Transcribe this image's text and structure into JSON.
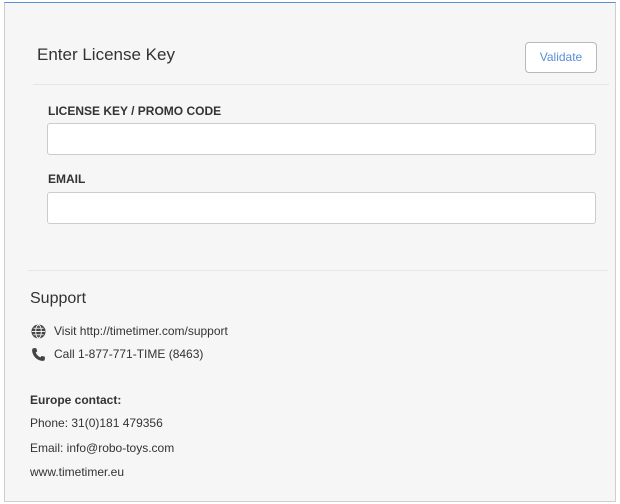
{
  "license_card": {
    "title": "Enter License Key",
    "validate_label": "Validate",
    "fields": {
      "license_key": {
        "label": "LICENSE KEY / PROMO CODE",
        "value": "",
        "placeholder": ""
      },
      "email": {
        "label": "EMAIL",
        "value": "",
        "placeholder": ""
      }
    }
  },
  "support": {
    "title": "Support",
    "web_icon": "globe-icon",
    "web_text": "Visit http://timetimer.com/support",
    "phone_icon": "phone-icon",
    "phone_text": "Call 1-877-771-TIME (8463)",
    "europe": {
      "heading": "Europe contact:",
      "phone": "Phone: 31(0)181 479356",
      "email": "Email: info@robo-toys.com",
      "website": "www.timetimer.eu"
    }
  },
  "colors": {
    "accent": "#5b8ed6",
    "panel_bg": "#f6f6f6",
    "text": "#333333"
  }
}
